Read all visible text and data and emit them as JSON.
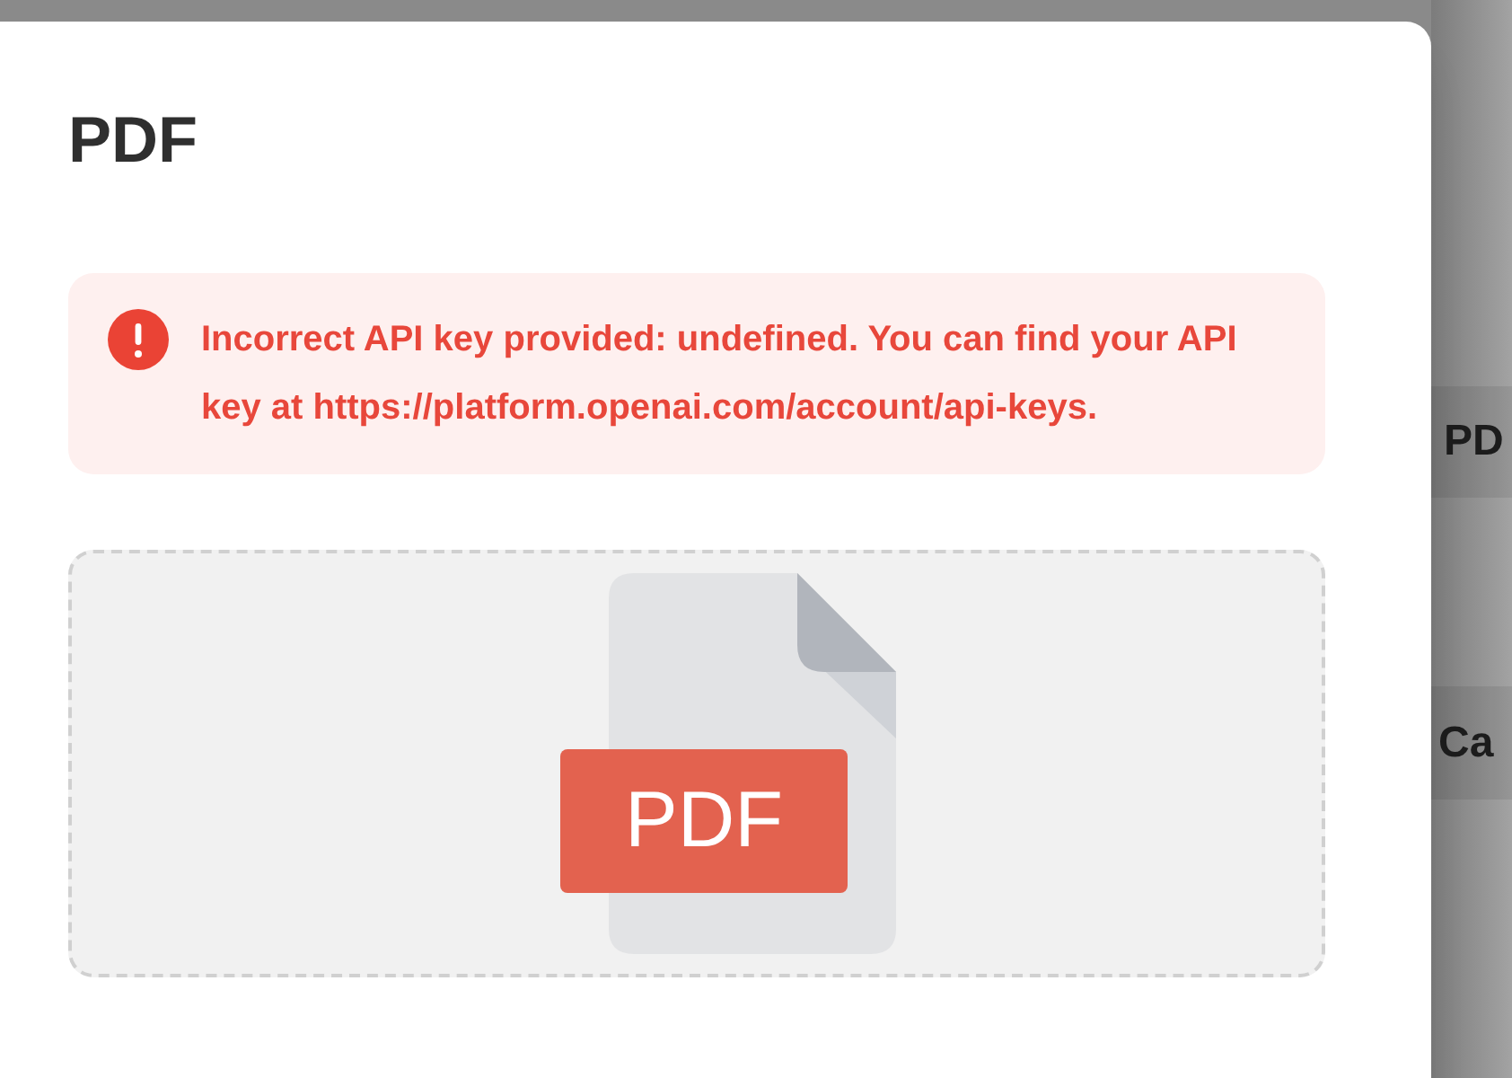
{
  "background": {
    "labels": [
      "PD",
      "Ca"
    ]
  },
  "dialog": {
    "title": "PDF",
    "error": {
      "message": "Incorrect API key provided: undefined. You can find your API key at https://platform.openai.com/account/api-keys."
    },
    "dropzone": {
      "file_badge": "PDF"
    }
  }
}
